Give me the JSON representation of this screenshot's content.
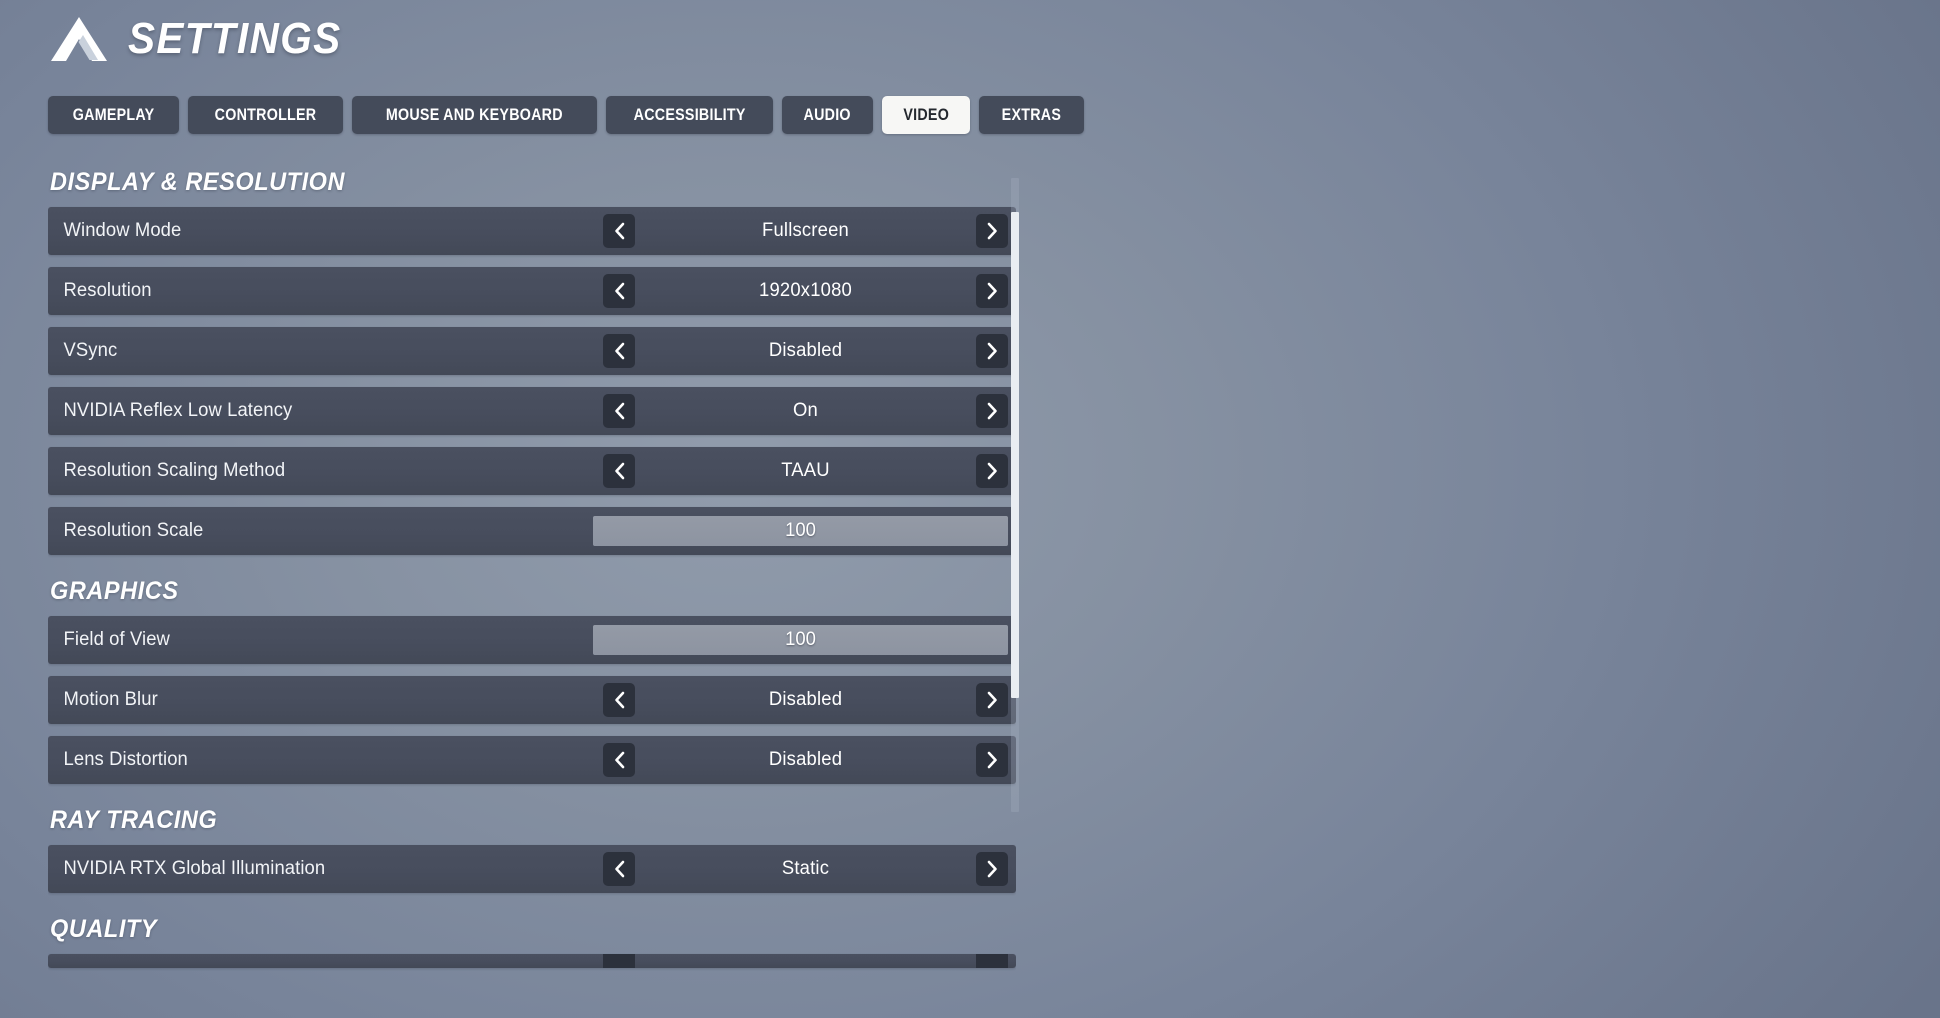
{
  "header": {
    "title": "SETTINGS",
    "logo_icon": "apex-triangle-logo-icon"
  },
  "tabs": [
    {
      "label": "GAMEPLAY",
      "active": false
    },
    {
      "label": "CONTROLLER",
      "active": false
    },
    {
      "label": "MOUSE AND KEYBOARD",
      "active": false
    },
    {
      "label": "ACCESSIBILITY",
      "active": false
    },
    {
      "label": "AUDIO",
      "active": false
    },
    {
      "label": "VIDEO",
      "active": true
    },
    {
      "label": "EXTRAS",
      "active": false
    }
  ],
  "sections": [
    {
      "title": "DISPLAY & RESOLUTION",
      "rows": [
        {
          "label": "Window Mode",
          "type": "stepper",
          "value": "Fullscreen"
        },
        {
          "label": "Resolution",
          "type": "stepper",
          "value": "1920x1080"
        },
        {
          "label": "VSync",
          "type": "stepper",
          "value": "Disabled"
        },
        {
          "label": "NVIDIA Reflex Low Latency",
          "type": "stepper",
          "value": "On"
        },
        {
          "label": "Resolution Scaling Method",
          "type": "stepper",
          "value": "TAAU"
        },
        {
          "label": "Resolution Scale",
          "type": "slider",
          "value": "100",
          "fill_percent": 100
        }
      ]
    },
    {
      "title": "GRAPHICS",
      "rows": [
        {
          "label": "Field of View",
          "type": "slider",
          "value": "100",
          "fill_percent": 100
        },
        {
          "label": "Motion Blur",
          "type": "stepper",
          "value": "Disabled"
        },
        {
          "label": "Lens Distortion",
          "type": "stepper",
          "value": "Disabled"
        }
      ]
    },
    {
      "title": "RAY TRACING",
      "rows": [
        {
          "label": "NVIDIA RTX Global Illumination",
          "type": "stepper",
          "value": "Static"
        }
      ]
    },
    {
      "title": "QUALITY",
      "rows": [
        {
          "label": "",
          "type": "partial",
          "value": ""
        }
      ]
    }
  ],
  "icons": {
    "prev_arrow": "chevron-left-icon",
    "next_arrow": "chevron-right-icon"
  },
  "colors": {
    "row_background": "#474d5d",
    "arrow_button": "#2c313c",
    "tab_inactive": "#444b5a",
    "tab_active": "#f7f7f5",
    "tab_active_text": "#25292f",
    "slider_fill": "#8d94a1",
    "slider_track": "#5a6070",
    "scrollbar_thumb": "#e9edf2",
    "text_primary": "#ffffff"
  },
  "scrollbar": {
    "thumb_position_percent": 5,
    "thumb_size_percent": 77
  }
}
